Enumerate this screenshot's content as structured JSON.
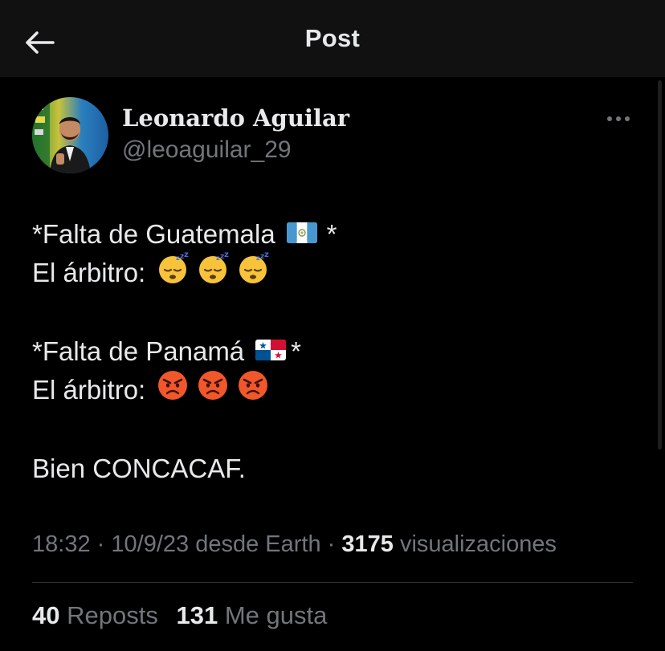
{
  "header": {
    "title": "Post",
    "back_icon": "arrow-left-icon"
  },
  "author": {
    "display_name": "Leonardo Aguilar",
    "handle": "@leoaguilar_29",
    "more_icon": "more-horizontal-icon"
  },
  "post": {
    "lines": [
      {
        "text": "*Falta de Guatemala",
        "flag": "guatemala-flag",
        "suffix": "*"
      },
      {
        "text": "El árbitro:",
        "emojis": [
          "sleeping-face",
          "sleeping-face",
          "sleeping-face"
        ]
      },
      {
        "text": "*Falta de Panamá",
        "flag": "panama-flag",
        "suffix": "*"
      },
      {
        "text": "El árbitro:",
        "emojis": [
          "angry-face",
          "angry-face",
          "angry-face"
        ]
      },
      {
        "text": "Bien CONCACAF."
      }
    ]
  },
  "meta": {
    "time": "18:32",
    "separator": "·",
    "date": "10/9/23",
    "source": "desde Earth",
    "views_count": "3175",
    "views_label": "visualizaciones"
  },
  "stats": {
    "reposts_count": "40",
    "reposts_label": "Reposts",
    "likes_count": "131",
    "likes_label": "Me gusta"
  },
  "colors": {
    "background": "#000000",
    "header_bg": "#111111",
    "text_primary": "#e7e9ea",
    "text_secondary": "#71767b",
    "divider": "#2f3336"
  }
}
